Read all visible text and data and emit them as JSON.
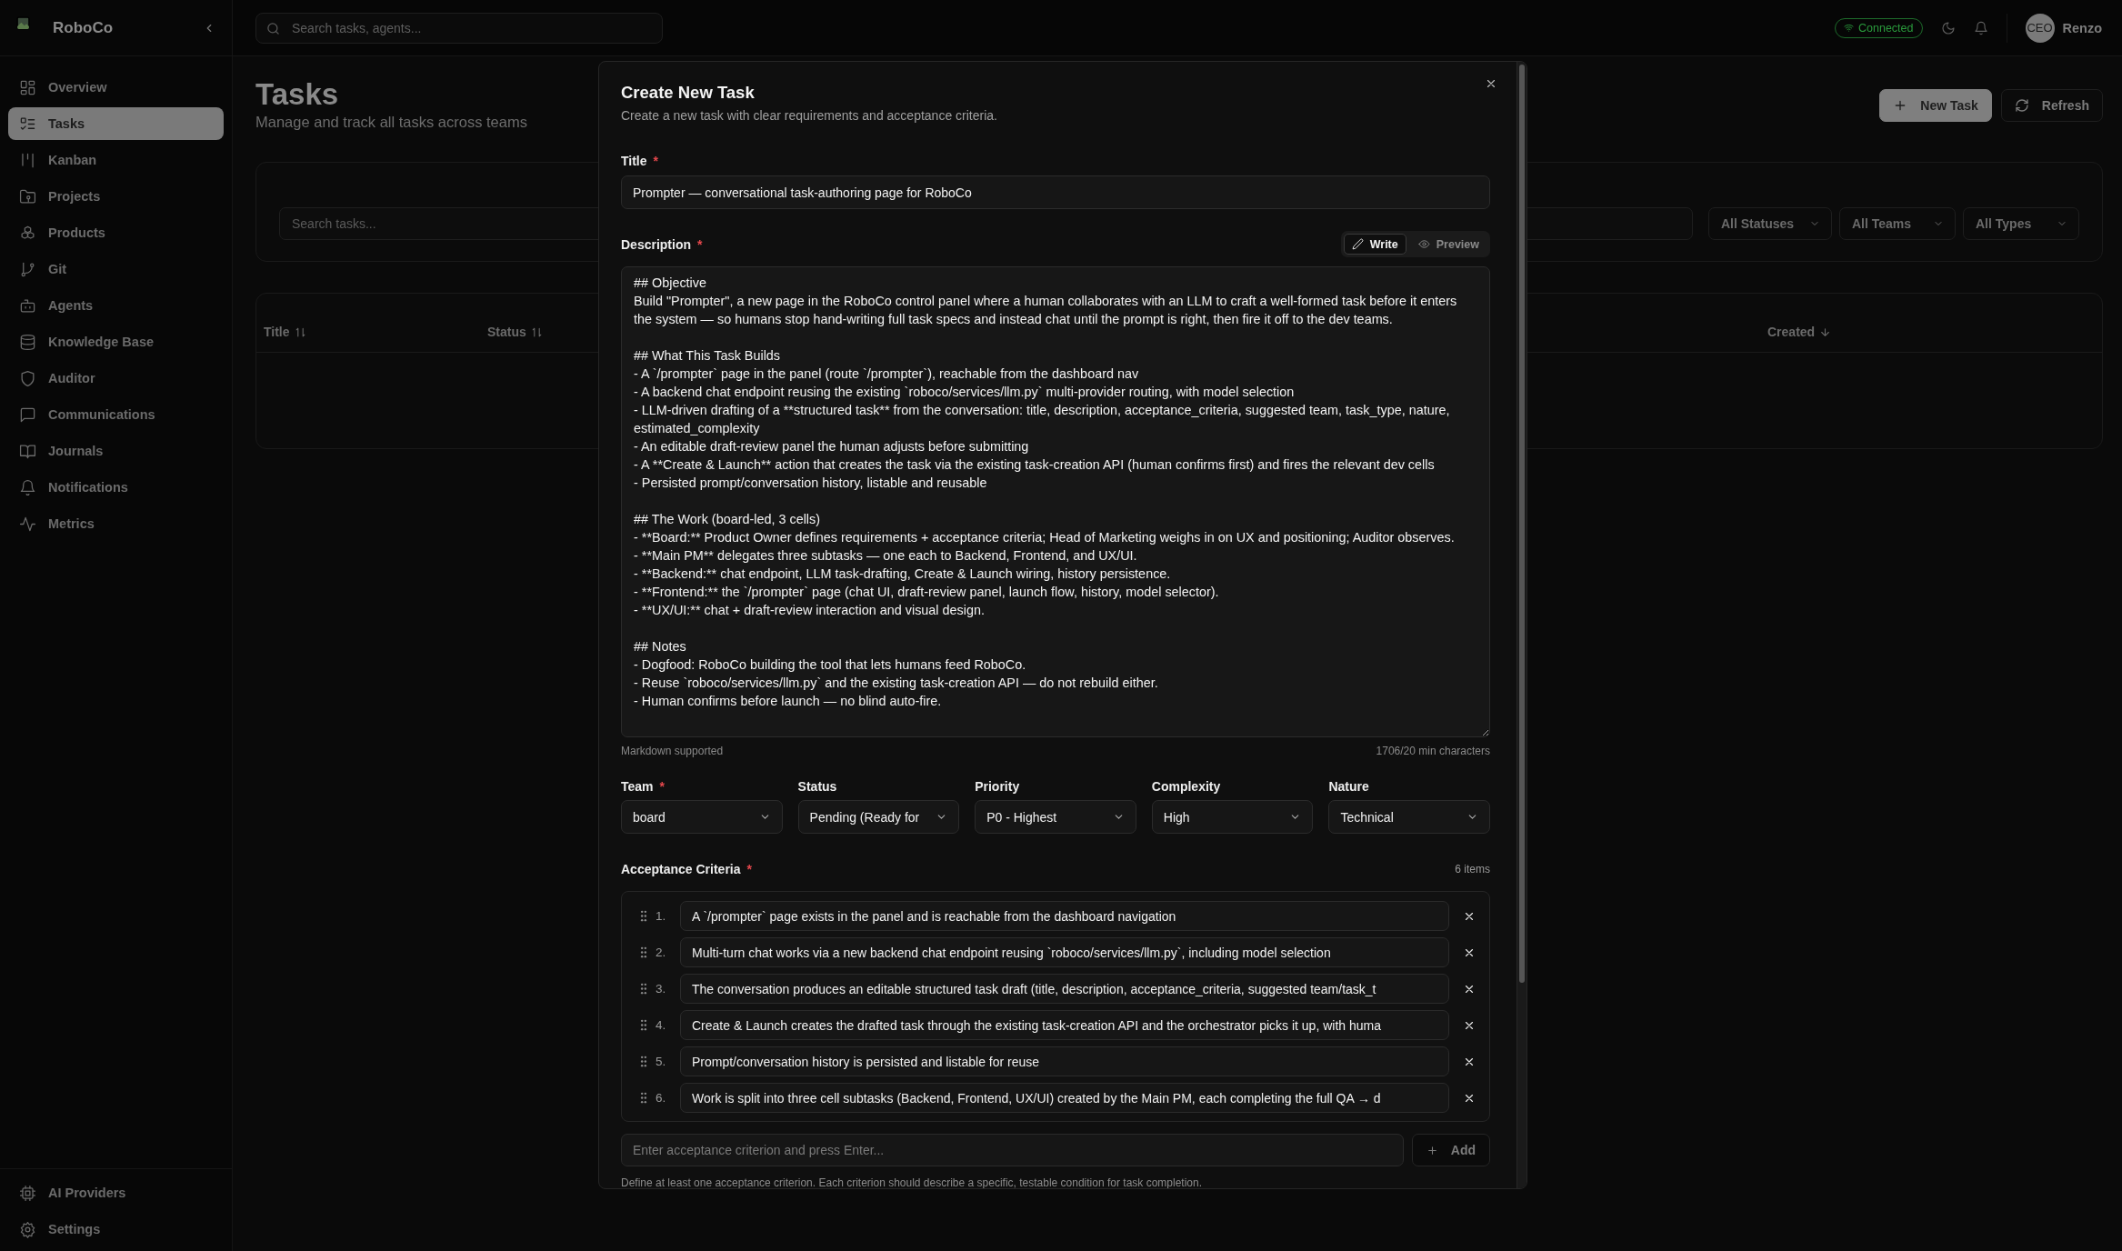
{
  "app": {
    "name": "RoboCo"
  },
  "sidebar": {
    "items": [
      {
        "label": "Overview",
        "selected": false
      },
      {
        "label": "Tasks",
        "selected": true
      },
      {
        "label": "Kanban",
        "selected": false
      },
      {
        "label": "Projects",
        "selected": false
      },
      {
        "label": "Products",
        "selected": false
      },
      {
        "label": "Git",
        "selected": false
      },
      {
        "label": "Agents",
        "selected": false
      },
      {
        "label": "Knowledge Base",
        "selected": false
      },
      {
        "label": "Auditor",
        "selected": false
      },
      {
        "label": "Communications",
        "selected": false
      },
      {
        "label": "Journals",
        "selected": false
      },
      {
        "label": "Notifications",
        "selected": false
      },
      {
        "label": "Metrics",
        "selected": false
      }
    ],
    "footer_items": [
      {
        "label": "AI Providers"
      },
      {
        "label": "Settings"
      }
    ]
  },
  "topbar": {
    "search": {
      "placeholder": "Search tasks, agents..."
    },
    "connection": {
      "label": "Connected",
      "connected": true
    },
    "user": {
      "initials": "CEO",
      "name": "Renzo"
    }
  },
  "page": {
    "title": "Tasks",
    "subtitle": "Manage and track all tasks across teams",
    "buttons": [
      {
        "label": "New Task",
        "kind": "primary"
      },
      {
        "label": "Refresh",
        "kind": "secondary"
      }
    ],
    "filters": {
      "search": {
        "placeholder": "Search tasks..."
      },
      "selects": [
        "All Statuses",
        "All Teams",
        "All Types"
      ]
    },
    "table": {
      "columns": [
        {
          "label": "Title",
          "sorted": false
        },
        {
          "label": "Status",
          "sorted": false
        },
        {
          "label": "Created",
          "sorted": true
        }
      ]
    }
  },
  "modal": {
    "title": "Create New Task",
    "subtitle": "Create a new task with clear requirements and acceptance criteria.",
    "title_field": {
      "label": "Title",
      "required_mark": "*",
      "value": "Prompter — conversational task-authoring page for RoboCo"
    },
    "description": {
      "label": "Description",
      "required_mark": "*",
      "modes": [
        {
          "label": "Write",
          "selected": true
        },
        {
          "label": "Preview",
          "selected": false
        }
      ],
      "value": "## Objective\nBuild \"Prompter\", a new page in the RoboCo control panel where a human collaborates with an LLM to craft a well-formed task before it enters the system — so humans stop hand-writing full task specs and instead chat until the prompt is right, then fire it off to the dev teams.\n\n## What This Task Builds\n- A `/prompter` page in the panel (route `/prompter`), reachable from the dashboard nav\n- A backend chat endpoint reusing the existing `roboco/services/llm.py` multi-provider routing, with model selection\n- LLM-driven drafting of a **structured task** from the conversation: title, description, acceptance_criteria, suggested team, task_type, nature, estimated_complexity\n- An editable draft-review panel the human adjusts before submitting\n- A **Create & Launch** action that creates the task via the existing task-creation API (human confirms first) and fires the relevant dev cells\n- Persisted prompt/conversation history, listable and reusable\n\n## The Work (board-led, 3 cells)\n- **Board:** Product Owner defines requirements + acceptance criteria; Head of Marketing weighs in on UX and positioning; Auditor observes.\n- **Main PM** delegates three subtasks — one each to Backend, Frontend, and UX/UI.\n- **Backend:** chat endpoint, LLM task-drafting, Create & Launch wiring, history persistence.\n- **Frontend:** the `/prompter` page (chat UI, draft-review panel, launch flow, history, model selector).\n- **UX/UI:** chat + draft-review interaction and visual design.\n\n## Notes\n- Dogfood: RoboCo building the tool that lets humans feed RoboCo.\n- Reuse `roboco/services/llm.py` and the existing task-creation API — do not rebuild either.\n- Human confirms before launch — no blind auto-fire.",
      "hint": "Markdown supported",
      "counter": "1706/20 min characters"
    },
    "selects": [
      {
        "label": "Team",
        "required_mark": "*",
        "value": "board"
      },
      {
        "label": "Status",
        "value": "Pending (Ready for"
      },
      {
        "label": "Priority",
        "value": "P0 - Highest"
      },
      {
        "label": "Complexity",
        "value": "High"
      },
      {
        "label": "Nature",
        "value": "Technical"
      }
    ],
    "acceptance_criteria": {
      "label": "Acceptance Criteria",
      "required_mark": "*",
      "count": "6 items",
      "items": [
        {
          "number": "1.",
          "text": "A `/prompter` page exists in the panel and is reachable from the dashboard navigation"
        },
        {
          "number": "2.",
          "text": "Multi-turn chat works via a new backend chat endpoint reusing `roboco/services/llm.py`, including model selection"
        },
        {
          "number": "3.",
          "text": "The conversation produces an editable structured task draft (title, description, acceptance_criteria, suggested team/task_t"
        },
        {
          "number": "4.",
          "text": "Create & Launch creates the drafted task through the existing task-creation API and the orchestrator picks it up, with huma"
        },
        {
          "number": "5.",
          "text": "Prompt/conversation history is persisted and listable for reuse"
        },
        {
          "number": "6.",
          "text": "Work is split into three cell subtasks (Backend, Frontend, UX/UI) created by the Main PM, each completing the full QA → d"
        }
      ],
      "new_item": {
        "placeholder": "Enter acceptance criterion and press Enter..."
      },
      "add_button": "Add",
      "help": "Define at least one acceptance criterion. Each criterion should describe a specific, testable condition for task completion."
    }
  }
}
